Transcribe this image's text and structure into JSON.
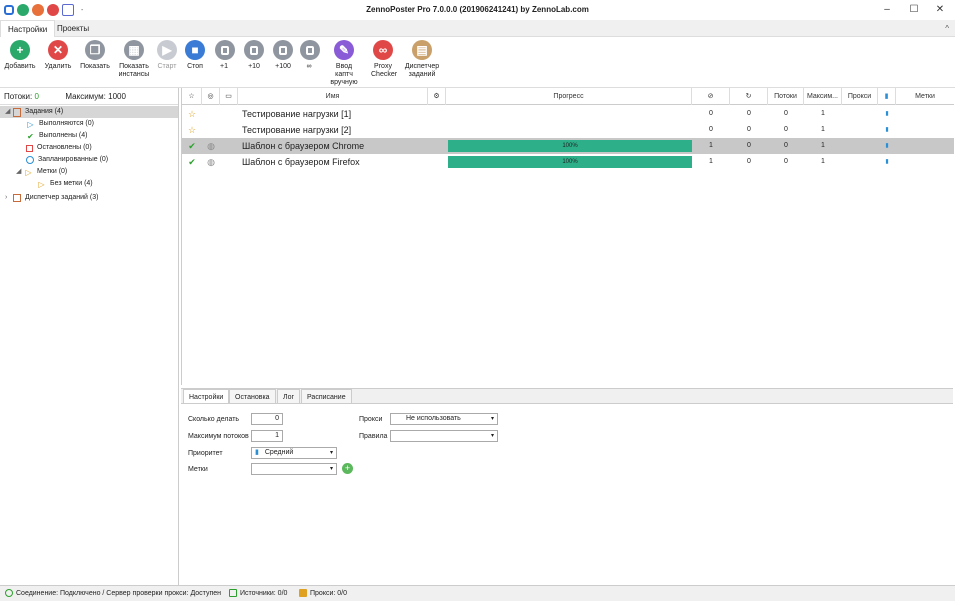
{
  "window": {
    "title": "ZennoPoster Pro 7.0.0.0 (201906241241) by ZennoLab.com"
  },
  "tabs": [
    {
      "label": "Настройки"
    },
    {
      "label": "Проекты"
    }
  ],
  "ribbon": {
    "buttons": [
      {
        "label": "Добавить",
        "color": "#2aa96b",
        "glyph": "+"
      },
      {
        "label": "Удалить",
        "color": "#e04848",
        "glyph": "✕"
      },
      {
        "label": "Показать",
        "color": "#8f96a0",
        "glyph": "❐"
      },
      {
        "label": "Показать инстансы",
        "color": "#8f96a0",
        "glyph": "▦"
      },
      {
        "label": "Старт",
        "color": "#c8ccd2",
        "glyph": "▶"
      },
      {
        "label": "Стоп",
        "color": "#3a7bd5",
        "glyph": "■"
      },
      {
        "label": "+1",
        "color": "#8f96a0",
        "glyph": ""
      },
      {
        "label": "+10",
        "color": "#8f96a0",
        "glyph": ""
      },
      {
        "label": "+100",
        "color": "#8f96a0",
        "glyph": ""
      },
      {
        "label": "∞",
        "color": "#8f96a0",
        "glyph": ""
      },
      {
        "label": "Ввод каптч вручную",
        "color": "#8a5bd6",
        "glyph": "✎"
      },
      {
        "label": "Proxy Checker",
        "color": "#e04848",
        "glyph": "∞"
      },
      {
        "label": "Диспетчер заданий",
        "color": "#c9a06a",
        "glyph": "▤"
      }
    ]
  },
  "left": {
    "threads_label": "Потоки:",
    "threads_value": "0",
    "max_label": "Максимум:",
    "max_value": "1000",
    "tree": [
      {
        "label": "Задания (4)"
      },
      {
        "label": "Выполняются (0)"
      },
      {
        "label": "Выполнены (4)"
      },
      {
        "label": "Остановлены (0)"
      },
      {
        "label": "Запланированные (0)"
      },
      {
        "label": "Метки (0)"
      },
      {
        "label": "Без метки (4)"
      },
      {
        "label": "Диспетчер заданий (3)"
      }
    ]
  },
  "grid": {
    "headers": {
      "name": "Имя",
      "progress": "Прогресс",
      "threads": "Потоки",
      "max": "Максим...",
      "proxy": "Прокси",
      "tags": "Метки"
    },
    "rows": [
      {
        "name": "Тестирование нагрузки [1]",
        "progress_label": "",
        "progress": 0,
        "c1": "0",
        "c2": "0",
        "threads": "0",
        "max": "1"
      },
      {
        "name": "Тестирование нагрузки [2]",
        "progress_label": "",
        "progress": 0,
        "c1": "0",
        "c2": "0",
        "threads": "0",
        "max": "1"
      },
      {
        "name": "Шаблон с браузером Chrome",
        "progress_label": "100%",
        "progress": 100,
        "c1": "1",
        "c2": "0",
        "threads": "0",
        "max": "1"
      },
      {
        "name": "Шаблон с браузером Firefox",
        "progress_label": "100%",
        "progress": 100,
        "c1": "1",
        "c2": "0",
        "threads": "0",
        "max": "1"
      }
    ]
  },
  "bottom_tabs": [
    {
      "label": "Настройки"
    },
    {
      "label": "Остановка"
    },
    {
      "label": "Лог"
    },
    {
      "label": "Расписание"
    }
  ],
  "settings": {
    "how_many_label": "Сколько делать",
    "how_many_value": "0",
    "max_threads_label": "Максимум потоков",
    "max_threads_value": "1",
    "priority_label": "Приоритет",
    "priority_value": "Средний",
    "tags_label": "Метки",
    "tags_value": "",
    "proxy_label": "Прокси",
    "proxy_value": "Не использовать",
    "rules_label": "Правила",
    "rules_value": ""
  },
  "status": {
    "connection": "Соединение: Подключено / Сервер проверки прокси: Доступен",
    "sources": "Источники: 0/0",
    "proxies": "Прокси: 0/0"
  }
}
